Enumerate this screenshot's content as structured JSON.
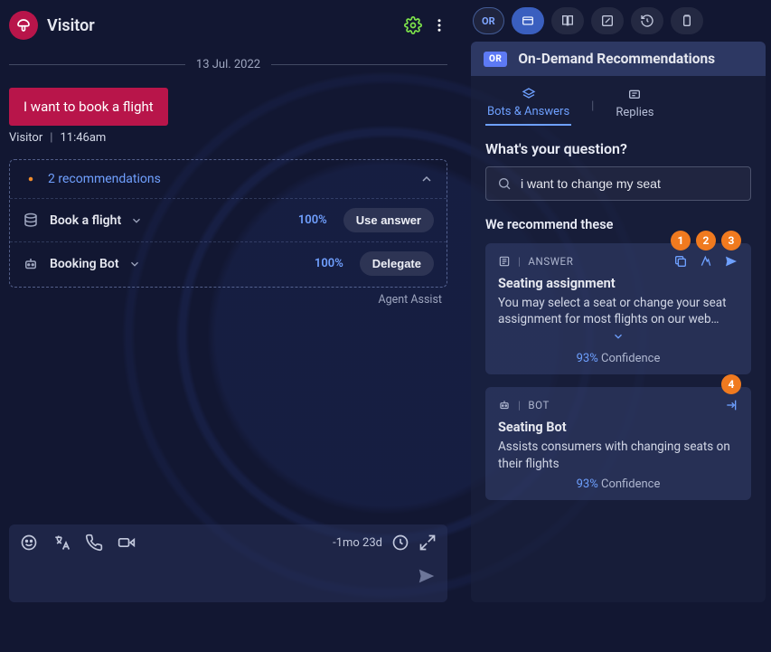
{
  "header": {
    "title": "Visitor"
  },
  "chat": {
    "date_label": "13 Jul. 2022",
    "message": {
      "text": "I want to book a flight",
      "author": "Visitor",
      "time": "11:46am"
    },
    "recs": {
      "title": "2 recommendations",
      "rows": [
        {
          "name": "Book a flight",
          "score": "100%",
          "action": "Use answer"
        },
        {
          "name": "Booking Bot",
          "score": "100%",
          "action": "Delegate"
        }
      ],
      "attribution": "Agent Assist"
    },
    "composer": {
      "age": "-1mo 23d"
    }
  },
  "side": {
    "iconbar": {
      "or_badge": "OR"
    },
    "odr": {
      "badge": "OR",
      "title": "On-Demand Recommendations",
      "tabs": {
        "bots": "Bots & Answers",
        "replies": "Replies"
      },
      "question_heading": "What's your question?",
      "search_value": "i want to change my seat",
      "recommend_heading": "We recommend these",
      "cards": [
        {
          "type": "ANSWER",
          "title": "Seating assignment",
          "body": "You may select a seat or change your seat assignment for most flights on our web…",
          "confidence_pct": "93%",
          "confidence_label": "Confidence"
        },
        {
          "type": "BOT",
          "title": "Seating Bot",
          "body": "Assists consumers with changing seats on their flights",
          "confidence_pct": "93%",
          "confidence_label": "Confidence"
        }
      ]
    }
  },
  "callouts": [
    "1",
    "2",
    "3",
    "4"
  ]
}
